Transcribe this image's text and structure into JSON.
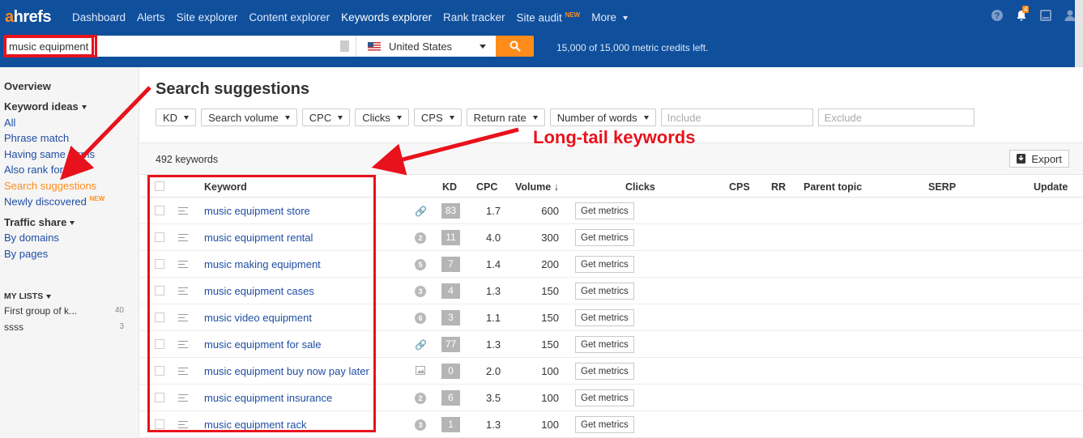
{
  "brand": {
    "logo_a": "a",
    "logo_rest": "hrefs",
    "accent": "#ff8c1a",
    "nav_bg": "#0f4f9c"
  },
  "nav": {
    "items": [
      "Dashboard",
      "Alerts",
      "Site explorer",
      "Content explorer",
      "Keywords explorer",
      "Rank tracker",
      "Site audit",
      "More"
    ],
    "new_badge": "NEW",
    "notification_count": "4"
  },
  "search": {
    "query": "music equipment",
    "country": "United States",
    "credits": "15,000 of 15,000 metric credits left."
  },
  "sidebar": {
    "overview": "Overview",
    "keyword_ideas": "Keyword ideas",
    "ideas_links": [
      "All",
      "Phrase match",
      "Having same terms",
      "Also rank for",
      "Search suggestions",
      "Newly discovered"
    ],
    "new_badge": "NEW",
    "traffic_share": "Traffic share",
    "traffic_links": [
      "By domains",
      "By pages"
    ],
    "my_lists": "MY LISTS",
    "lists": [
      {
        "name": "First group of k...",
        "count": "40"
      },
      {
        "name": "ssss",
        "count": "3"
      }
    ]
  },
  "main": {
    "title": "Search suggestions",
    "filters": [
      "KD",
      "Search volume",
      "CPC",
      "Clicks",
      "CPS",
      "Return rate",
      "Number of words"
    ],
    "include_placeholder": "Include",
    "exclude_placeholder": "Exclude",
    "keyword_count": "492 keywords",
    "export_label": "Export",
    "columns": [
      "Keyword",
      "KD",
      "CPC",
      "Volume",
      "Clicks",
      "CPS",
      "RR",
      "Parent topic",
      "SERP",
      "Update"
    ],
    "get_metrics_label": "Get metrics",
    "rows": [
      {
        "keyword": "music equipment store",
        "serp": "link",
        "kd": "83",
        "cpc": "1.7",
        "volume": "600"
      },
      {
        "keyword": "music equipment rental",
        "serp": "2",
        "kd": "11",
        "cpc": "4.0",
        "volume": "300"
      },
      {
        "keyword": "music making equipment",
        "serp": "5",
        "kd": "7",
        "cpc": "1.4",
        "volume": "200"
      },
      {
        "keyword": "music equipment cases",
        "serp": "3",
        "kd": "4",
        "cpc": "1.3",
        "volume": "150"
      },
      {
        "keyword": "music video equipment",
        "serp": "6",
        "kd": "3",
        "cpc": "1.1",
        "volume": "150"
      },
      {
        "keyword": "music equipment for sale",
        "serp": "link",
        "kd": "77",
        "cpc": "1.3",
        "volume": "150"
      },
      {
        "keyword": "music equipment buy now pay later",
        "serp": "image",
        "kd": "0",
        "cpc": "2.0",
        "volume": "100"
      },
      {
        "keyword": "music equipment insurance",
        "serp": "2",
        "kd": "6",
        "cpc": "3.5",
        "volume": "100"
      },
      {
        "keyword": "music equipment rack",
        "serp": "3",
        "kd": "1",
        "cpc": "1.3",
        "volume": "100"
      }
    ]
  },
  "annotation": {
    "label": "Long-tail keywords",
    "color": "#e8121c"
  }
}
